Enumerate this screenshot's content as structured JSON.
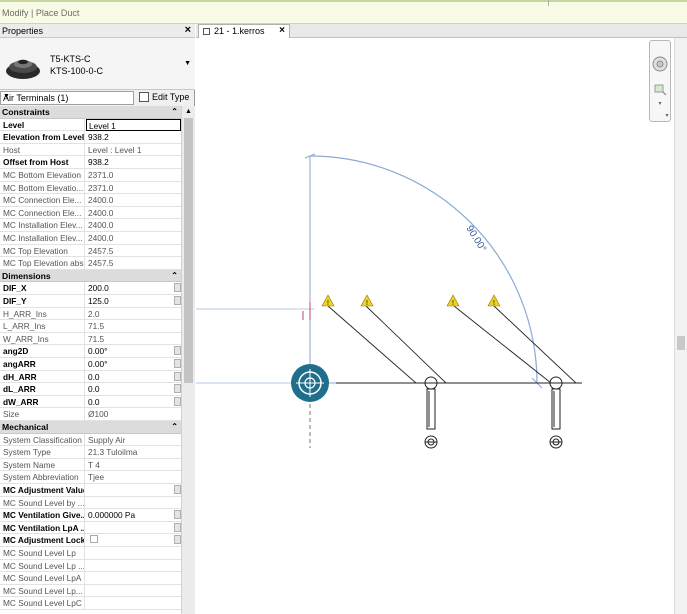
{
  "mode_title": "Modify | Place Duct",
  "properties": {
    "title": "Properties",
    "type_name_1": "T5-KTS-C",
    "type_name_2": "KTS-100-0-C",
    "filter": "Air Terminals (1)",
    "edit_type": "Edit Type",
    "groups": [
      {
        "name": "Constraints",
        "rows": [
          {
            "n": "Level",
            "v": "Level 1",
            "style": "b"
          },
          {
            "n": "Elevation from Level",
            "v": "938.2",
            "style": "b"
          },
          {
            "n": "Host",
            "v": "Level : Level 1",
            "style": ""
          },
          {
            "n": "Offset from Host",
            "v": "938.2",
            "style": "b"
          },
          {
            "n": "MC Bottom Elevation",
            "v": "2371.0",
            "style": ""
          },
          {
            "n": "MC Bottom Elevatio...",
            "v": "2371.0",
            "style": ""
          },
          {
            "n": "MC Connection Ele...",
            "v": "2400.0",
            "style": ""
          },
          {
            "n": "MC Connection Ele...",
            "v": "2400.0",
            "style": ""
          },
          {
            "n": "MC Installation Elev...",
            "v": "2400.0",
            "style": ""
          },
          {
            "n": "MC Installation Elev...",
            "v": "2400.0",
            "style": ""
          },
          {
            "n": "MC Top Elevation",
            "v": "2457.5",
            "style": ""
          },
          {
            "n": "MC Top Elevation abs",
            "v": "2457.5",
            "style": ""
          }
        ]
      },
      {
        "name": "Dimensions",
        "rows": [
          {
            "n": "DIF_X",
            "v": "200.0",
            "style": "b"
          },
          {
            "n": "DIF_Y",
            "v": "125.0",
            "style": "b"
          },
          {
            "n": "H_ARR_Ins",
            "v": "2.0",
            "style": ""
          },
          {
            "n": "L_ARR_Ins",
            "v": "71.5",
            "style": ""
          },
          {
            "n": "W_ARR_Ins",
            "v": "71.5",
            "style": ""
          },
          {
            "n": "ang2D",
            "v": "0.00°",
            "style": "b"
          },
          {
            "n": "angARR",
            "v": "0.00°",
            "style": "b"
          },
          {
            "n": "dH_ARR",
            "v": "0.0",
            "style": "b"
          },
          {
            "n": "dL_ARR",
            "v": "0.0",
            "style": "b"
          },
          {
            "n": "dW_ARR",
            "v": "0.0",
            "style": "b"
          },
          {
            "n": "Size",
            "v": "Ø100",
            "style": ""
          }
        ]
      },
      {
        "name": "Mechanical",
        "rows": [
          {
            "n": "System Classification",
            "v": "Supply Air",
            "style": ""
          },
          {
            "n": "System Type",
            "v": "21.3 Tuloilma",
            "style": ""
          },
          {
            "n": "System Name",
            "v": "T 4",
            "style": ""
          },
          {
            "n": "System Abbreviation",
            "v": "Tjee",
            "style": ""
          },
          {
            "n": "MC Adjustment Value",
            "v": "",
            "style": "b"
          },
          {
            "n": "MC Sound Level by ...",
            "v": "",
            "style": ""
          },
          {
            "n": "MC Ventilation Give...",
            "v": "0.000000 Pa",
            "style": "b"
          },
          {
            "n": "MC Ventilation LpA ...",
            "v": "",
            "style": "b"
          },
          {
            "n": "MC Adjustment Lock",
            "v": "",
            "style": "b"
          },
          {
            "n": "MC Sound Level Lp",
            "v": "",
            "style": ""
          },
          {
            "n": "MC Sound Level Lp ...",
            "v": "",
            "style": ""
          },
          {
            "n": "MC Sound Level LpA",
            "v": "",
            "style": ""
          },
          {
            "n": "MC Sound Level Lp...",
            "v": "",
            "style": ""
          },
          {
            "n": "MC Sound Level LpC",
            "v": "",
            "style": ""
          }
        ]
      }
    ]
  },
  "view_tab": {
    "label": "21 - 1.kerros"
  },
  "canvas": {
    "angle_label": "90.00°"
  },
  "colors": {
    "warning": "#f2d21a",
    "arc": "#8aaad8",
    "terminal": "#1f6e8c"
  }
}
